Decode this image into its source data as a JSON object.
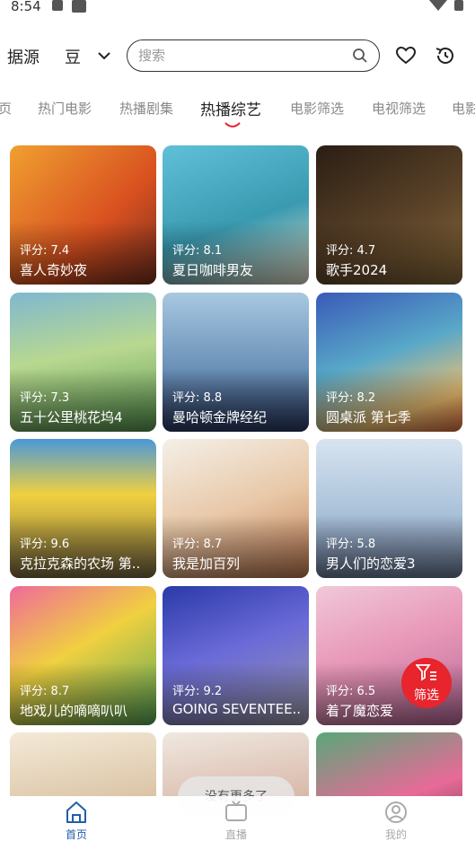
{
  "status_bar": {
    "time": "8:54"
  },
  "header": {
    "source_label": "据源",
    "source_value": "豆",
    "search_placeholder": "搜索"
  },
  "tabs": [
    {
      "label": "页"
    },
    {
      "label": "热门电影"
    },
    {
      "label": "热播剧集"
    },
    {
      "label": "热播综艺",
      "active": true
    },
    {
      "label": "电影筛选"
    },
    {
      "label": "电视筛选"
    },
    {
      "label": "电影"
    }
  ],
  "score_prefix": "评分:",
  "cards": [
    {
      "score": "7.4",
      "title": "喜人奇妙夜"
    },
    {
      "score": "8.1",
      "title": "夏日咖啡男友"
    },
    {
      "score": "4.7",
      "title": "歌手2024"
    },
    {
      "score": "7.3",
      "title": "五十公里桃花坞4"
    },
    {
      "score": "8.8",
      "title": "曼哈顿金牌经纪"
    },
    {
      "score": "8.2",
      "title": "圆桌派 第七季"
    },
    {
      "score": "9.6",
      "title": "克拉克森的农场 第.."
    },
    {
      "score": "8.7",
      "title": "我是加百列"
    },
    {
      "score": "5.8",
      "title": "男人们的恋爱3"
    },
    {
      "score": "8.7",
      "title": "地戏儿的嘀嘀叭叭"
    },
    {
      "score": "9.2",
      "title": "GOING SEVENTEE.."
    },
    {
      "score": "6.5",
      "title": "着了魔恋爱"
    },
    {
      "score": "",
      "title": ""
    },
    {
      "score": "",
      "title": ""
    },
    {
      "score": "",
      "title": ""
    }
  ],
  "filter_fab": {
    "label": "筛选"
  },
  "toast": {
    "text": "没有更多了"
  },
  "bottom_nav": [
    {
      "label": "首页",
      "active": true,
      "icon": "home-icon"
    },
    {
      "label": "直播",
      "active": false,
      "icon": "tv-icon"
    },
    {
      "label": "我的",
      "active": false,
      "icon": "profile-icon"
    }
  ],
  "colors": {
    "accent_red": "#e8242d",
    "nav_active": "#1f5fa8",
    "nav_inactive": "#aaaaaa"
  }
}
